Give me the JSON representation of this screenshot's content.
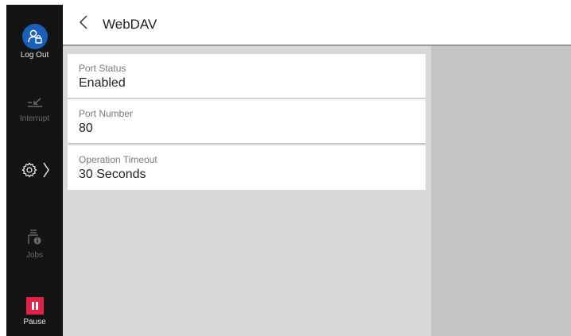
{
  "sidebar": {
    "logout_label": "Log Out",
    "interrupt_label": "Interrupt",
    "jobs_label": "Jobs",
    "pause_label": "Pause"
  },
  "header": {
    "title": "WebDAV"
  },
  "settings": {
    "items": [
      {
        "label": "Port Status",
        "value": "Enabled"
      },
      {
        "label": "Port Number",
        "value": "80"
      },
      {
        "label": "Operation Timeout",
        "value": "30 Seconds"
      }
    ]
  },
  "icons": {
    "logout": "user-logout-icon",
    "interrupt": "interrupt-icon",
    "settings": "gear-icon",
    "jobs": "jobs-info-icon",
    "pause": "pause-icon",
    "back": "chevron-left-icon"
  },
  "colors": {
    "sidebar_bg": "#141414",
    "logout_accent": "#1c5fb8",
    "pause_accent": "#e3224b",
    "content_bg": "#d8d8d6",
    "right_panel_bg": "#c4c4c2"
  }
}
